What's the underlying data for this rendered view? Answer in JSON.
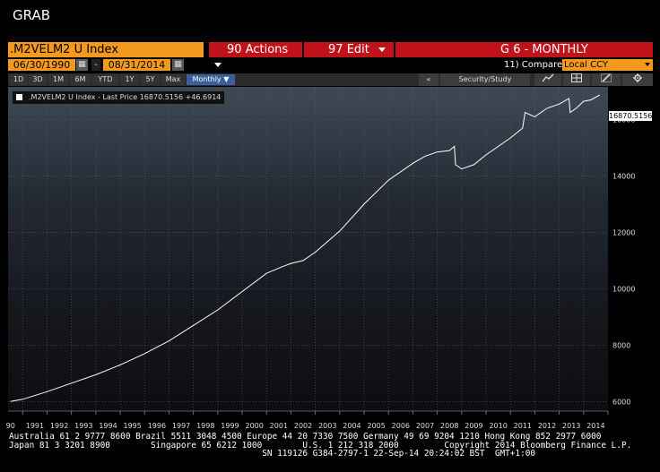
{
  "window": {
    "title": "GRAB"
  },
  "header": {
    "ticker": ".M2VELM2 U Index",
    "actions_num": "90",
    "actions_label": "Actions",
    "edit_num": "97",
    "edit_label": "Edit",
    "graph_label": "G 6 - MONTHLY"
  },
  "dates": {
    "start": "06/30/1990",
    "end": "08/31/2014",
    "sep": "-"
  },
  "compare": {
    "label": "11) Compare",
    "value": "Local CCY"
  },
  "periods": [
    "1D",
    "3D",
    "1M",
    "6M",
    "YTD",
    "1Y",
    "5Y",
    "Max"
  ],
  "frequency": "Monthly",
  "right_toolbar": {
    "collapse": "«",
    "security_study": "Security/Study"
  },
  "legend": {
    "text": ".M2VELM2 U Index - Last Price 16870.5156 +46.6914"
  },
  "last_value_label": "16870.5156",
  "chart_data": {
    "type": "line",
    "series": [
      {
        "name": ".M2VELM2 U Index - Last Price",
        "color": "#ffffff"
      }
    ],
    "x": [
      1990.5,
      1991.0,
      1992.0,
      1993.0,
      1994.0,
      1995.0,
      1996.0,
      1997.0,
      1998.0,
      1999.0,
      2000.0,
      2001.0,
      2001.7,
      2002.0,
      2002.5,
      2003.0,
      2004.0,
      2005.0,
      2006.0,
      2007.0,
      2007.5,
      2008.0,
      2008.5,
      2008.7,
      2008.75,
      2009.0,
      2009.5,
      2010.0,
      2011.0,
      2011.5,
      2011.6,
      2012.0,
      2012.5,
      2013.0,
      2013.2,
      2013.4,
      2013.45,
      2013.7,
      2014.0,
      2014.3,
      2014.66
    ],
    "y": [
      6000,
      6080,
      6350,
      6650,
      6950,
      7300,
      7700,
      8150,
      8700,
      9250,
      9900,
      10550,
      10800,
      10900,
      11000,
      11300,
      12050,
      13000,
      13850,
      14450,
      14700,
      14850,
      14900,
      15050,
      14400,
      14250,
      14400,
      14750,
      15350,
      15700,
      16250,
      16100,
      16400,
      16550,
      16650,
      16750,
      16250,
      16400,
      16650,
      16700,
      16870.5156
    ],
    "x_ticks": [
      "90",
      "1991",
      "1992",
      "1993",
      "1994",
      "1995",
      "1996",
      "1997",
      "1998",
      "1999",
      "2000",
      "2001",
      "2002",
      "2003",
      "2004",
      "2005",
      "2006",
      "2007",
      "2008",
      "2009",
      "2010",
      "2011",
      "2012",
      "2013",
      "2014"
    ],
    "x_tick_values": [
      1990.5,
      1991.5,
      1992.5,
      1993.5,
      1994.5,
      1995.5,
      1996.5,
      1997.5,
      1998.5,
      1999.5,
      2000.5,
      2001.5,
      2002.5,
      2003.5,
      2004.5,
      2005.5,
      2006.5,
      2007.5,
      2008.5,
      2009.5,
      2010.5,
      2011.5,
      2012.5,
      2013.5,
      2014.5
    ],
    "x_gridlines": [
      1991,
      1992,
      1993,
      1994,
      1995,
      1996,
      1997,
      1998,
      1999,
      2000,
      2001,
      2002,
      2003,
      2004,
      2005,
      2006,
      2007,
      2008,
      2009,
      2010,
      2011,
      2012,
      2013,
      2014
    ],
    "y_ticks": [
      6000,
      8000,
      10000,
      12000,
      14000,
      16000
    ],
    "xlim": [
      1990.4,
      2015.0
    ],
    "ylim": [
      5660,
      17160
    ],
    "grid": true,
    "legend_position": "top-left"
  },
  "footer": {
    "line1": "Australia 61 2 9777 8600 Brazil 5511 3048 4500 Europe 44 20 7330 7500 Germany 49 69 9204 1210 Hong Kong 852 2977 6000",
    "line2": "Japan 81 3 3201 8900        Singapore 65 6212 1000        U.S. 1 212 318 2000         Copyright 2014 Bloomberg Finance L.P.",
    "line3": "                                                  SN 119126 G384-2797-1 22-Sep-14 20:24:02 BST  GMT+1:00"
  },
  "colors": {
    "orange": "#f39a1e",
    "red": "#c0121b",
    "active_blue": "#3a5f9a"
  }
}
